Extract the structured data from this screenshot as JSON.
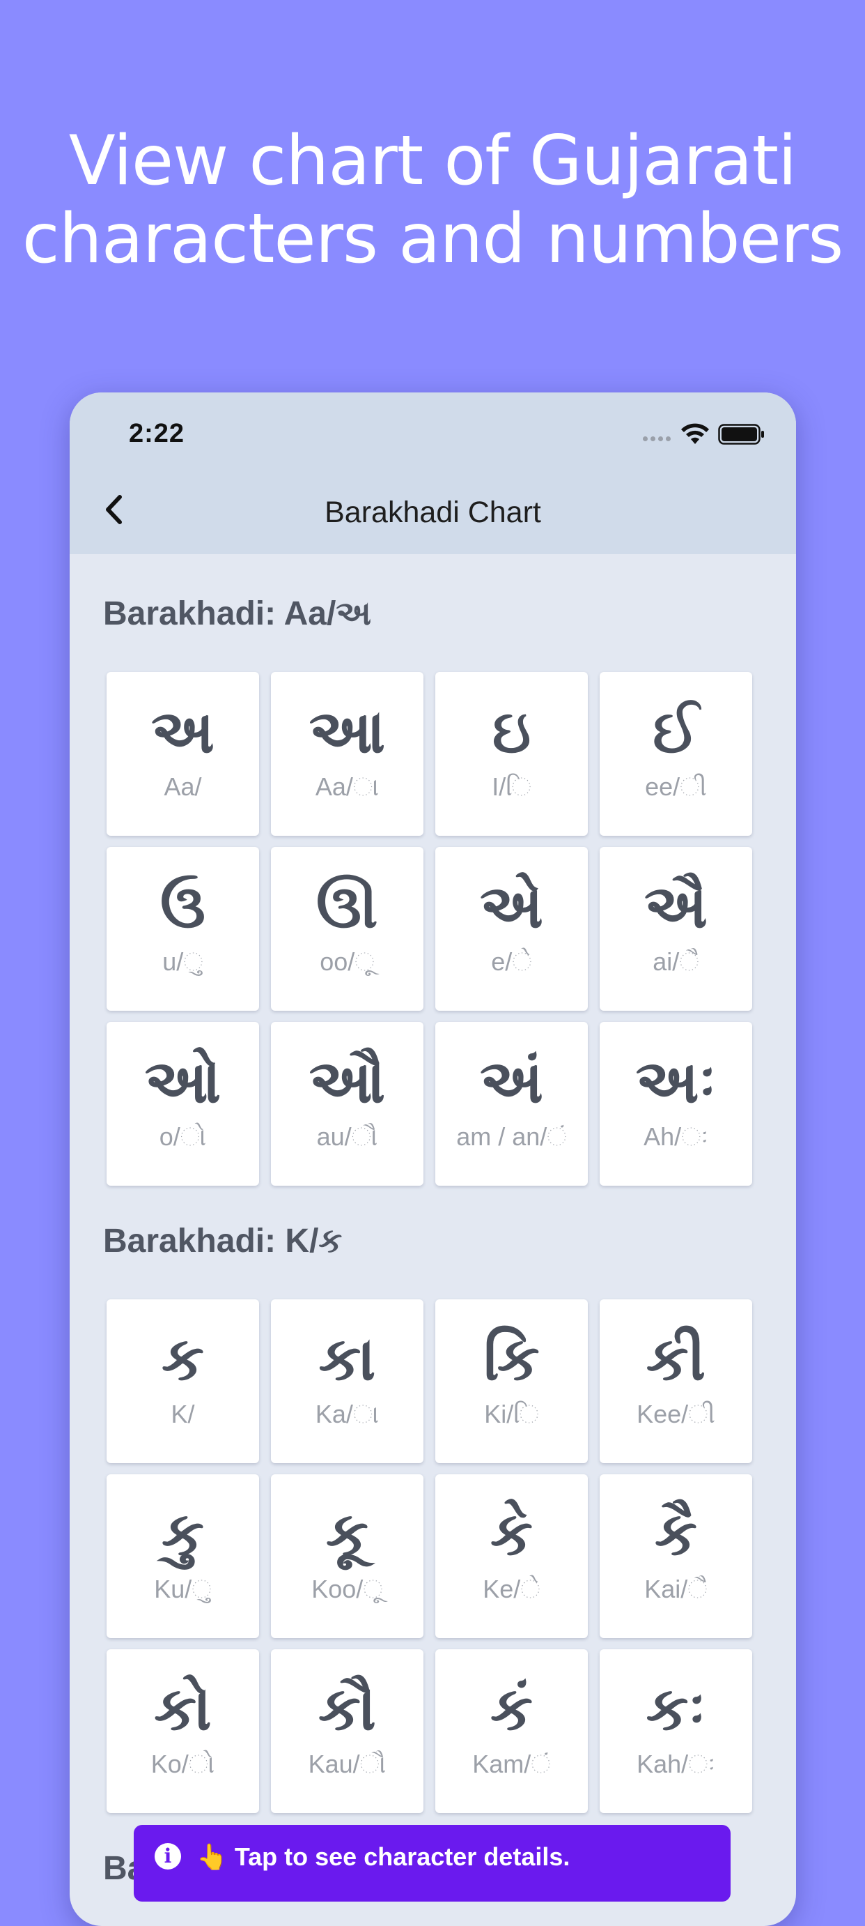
{
  "headline": {
    "line1": "View chart of Gujarati",
    "line2": "characters and numbers"
  },
  "status_bar": {
    "time": "2:22",
    "icons": [
      "cellular-signal-icon",
      "wifi-icon",
      "battery-icon"
    ]
  },
  "nav": {
    "back_icon": "chevron-left-icon",
    "title": "Barakhadi Chart"
  },
  "sections": [
    {
      "title": "Barakhadi: Aa/અ",
      "cards": [
        {
          "glyph": "અ",
          "label": "Aa/"
        },
        {
          "glyph": "આ",
          "label": "Aa/ા"
        },
        {
          "glyph": "ઇ",
          "label": "I/િ"
        },
        {
          "glyph": "ઈ",
          "label": "ee/ી"
        },
        {
          "glyph": "ઉ",
          "label": "u/ુ"
        },
        {
          "glyph": "ઊ",
          "label": "oo/ૂ"
        },
        {
          "glyph": "એ",
          "label": "e/ે"
        },
        {
          "glyph": "ઐ",
          "label": "ai/ૈ"
        },
        {
          "glyph": "ઓ",
          "label": "o/ો"
        },
        {
          "glyph": "ઔ",
          "label": "au/ૌ"
        },
        {
          "glyph": "અં",
          "label": "am / an/ં"
        },
        {
          "glyph": "અઃ",
          "label": "Ah/ઃ"
        }
      ]
    },
    {
      "title": "Barakhadi: K/ક",
      "cards": [
        {
          "glyph": "ક",
          "label": "K/"
        },
        {
          "glyph": "કા",
          "label": "Ka/ા"
        },
        {
          "glyph": "કિ",
          "label": "Ki/િ"
        },
        {
          "glyph": "કી",
          "label": "Kee/ી"
        },
        {
          "glyph": "કુ",
          "label": "Ku/ુ"
        },
        {
          "glyph": "કૂ",
          "label": "Koo/ૂ"
        },
        {
          "glyph": "કે",
          "label": "Ke/ે"
        },
        {
          "glyph": "કૈ",
          "label": "Kai/ૈ"
        },
        {
          "glyph": "કો",
          "label": "Ko/ો"
        },
        {
          "glyph": "કૌ",
          "label": "Kau/ૌ"
        },
        {
          "glyph": "કં",
          "label": "Kam/ં"
        },
        {
          "glyph": "કઃ",
          "label": "Kah/ઃ"
        }
      ]
    },
    {
      "title": "Ba"
    }
  ],
  "toast": {
    "icon": "info-icon",
    "text": "👆 Tap to see character details."
  },
  "colors": {
    "background": "#8A8BFF",
    "device_background": "#E3E8F2",
    "nav_bar": "#D0DBEA",
    "toast": "#6A1AEE",
    "glyph_text": "#4A505C",
    "label_text": "#9CA0A8"
  }
}
